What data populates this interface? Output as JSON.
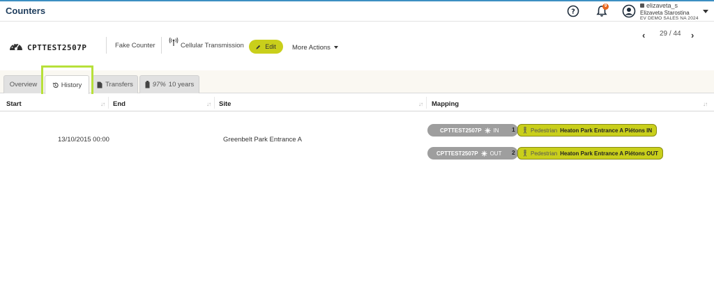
{
  "app": {
    "title": "Counters"
  },
  "user": {
    "username": "elizaveta_s",
    "full_name": "Elizaveta Starostina",
    "org": "EV DEMO SALES NA 2024",
    "notification_count": "9"
  },
  "pager": {
    "text": "29 / 44"
  },
  "counter": {
    "name": "CPTTEST2507P",
    "type": "Fake Counter",
    "transmission": "Cellular Transmission"
  },
  "actions": {
    "edit": "Edit",
    "more": "More Actions"
  },
  "tabs": [
    {
      "label": "Overview"
    },
    {
      "label": "History"
    },
    {
      "label": "Transfers"
    },
    {
      "label_pct": "97%",
      "label_years": "10 years"
    }
  ],
  "table": {
    "headers": [
      "Start",
      "End",
      "Site",
      "Mapping"
    ],
    "rows": [
      {
        "start": "",
        "end": "13/10/2015 00:00",
        "site": "Greenbelt Park Entrance A",
        "mappings": [
          {
            "channel": "CPTTEST2507P",
            "direction": "IN",
            "index": "1",
            "type": "Pedestrian",
            "name": "Heaton Park Entrance A Piétons IN"
          },
          {
            "channel": "CPTTEST2507P",
            "direction": "OUT",
            "index": "2",
            "type": "Pedestrian",
            "name": "Heaton Park Entrance A Piétons OUT"
          }
        ]
      }
    ]
  },
  "colors": {
    "accent": "#c9cf1b",
    "highlight": "#b7e03a",
    "topbar_border": "#3c8fc2",
    "badge": "#e8661c"
  }
}
